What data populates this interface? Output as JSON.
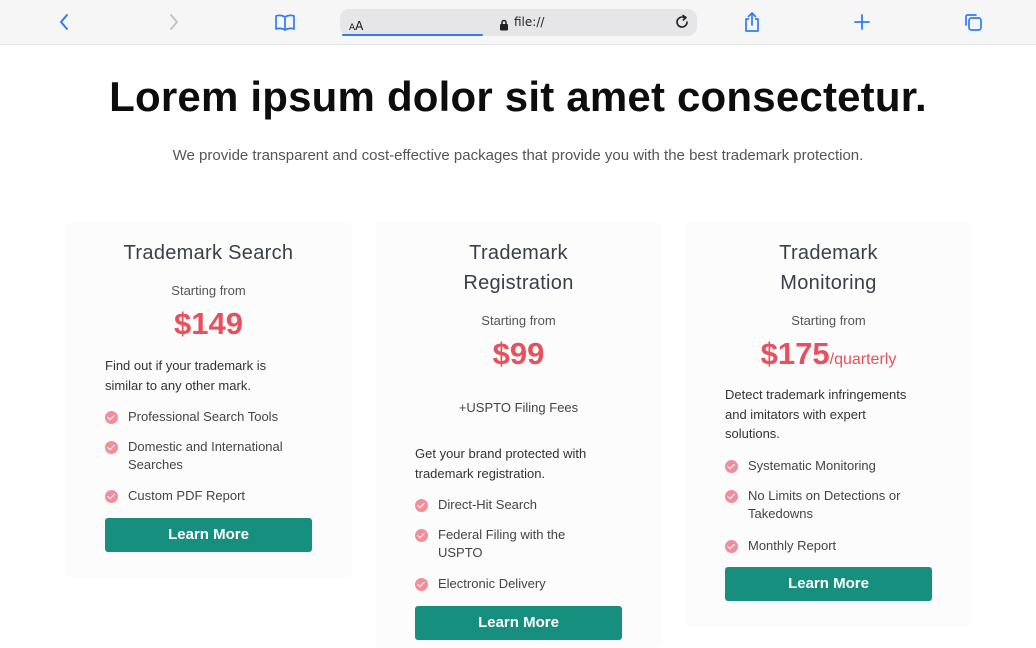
{
  "browser": {
    "url_text": "file://",
    "aa_small": "A",
    "aa_big": "A",
    "icons": [
      "back-icon",
      "forward-icon",
      "bookmarks-icon",
      "lock-icon",
      "reload-icon",
      "share-icon",
      "new-tab-icon",
      "tabs-icon"
    ]
  },
  "page": {
    "headline": "Lorem ipsum dolor sit amet consectetur.",
    "subline": "We provide transparent and cost-effective packages that provide you with the best trademark protection."
  },
  "cards": [
    {
      "title_line1": "Trademark Search",
      "title_line2": "",
      "starting": "Starting from",
      "price": "$149",
      "price_suffix": "",
      "fees": "",
      "desc_line1": "Find out if your trademark is",
      "desc_line2": "similar to any other mark.",
      "desc_line3": "",
      "features": [
        {
          "line1": "Professional Search Tools",
          "line2": ""
        },
        {
          "line1": "Domestic and International",
          "line2": "Searches"
        },
        {
          "line1": "Custom PDF Report",
          "line2": ""
        }
      ],
      "button": "Learn More"
    },
    {
      "title_line1": "Trademark",
      "title_line2": "Registration",
      "starting": "Starting from",
      "price": "$99",
      "price_suffix": "",
      "fees": "+USPTO Filing Fees",
      "desc_line1": "Get your brand protected with",
      "desc_line2": "trademark registration.",
      "desc_line3": "",
      "features": [
        {
          "line1": "Direct-Hit Search",
          "line2": ""
        },
        {
          "line1": "Federal Filing with the",
          "line2": "USPTO"
        },
        {
          "line1": "Electronic Delivery",
          "line2": ""
        }
      ],
      "button": "Learn More"
    },
    {
      "title_line1": "Trademark",
      "title_line2": "Monitoring",
      "starting": "Starting from",
      "price": "$175",
      "price_suffix": "/quarterly",
      "fees": "",
      "desc_line1": "Detect trademark infringements",
      "desc_line2": "and imitators with expert",
      "desc_line3": "solutions.",
      "features": [
        {
          "line1": "Systematic Monitoring",
          "line2": ""
        },
        {
          "line1": "No Limits on Detections or",
          "line2": "Takedowns"
        },
        {
          "line1": "Monthly Report",
          "line2": ""
        }
      ],
      "button": "Learn More"
    }
  ],
  "colors": {
    "price_red": "#e8505b",
    "button_teal": "#178f7e",
    "check_pink": "#f38d97",
    "ios_blue": "#2f7cf6"
  }
}
